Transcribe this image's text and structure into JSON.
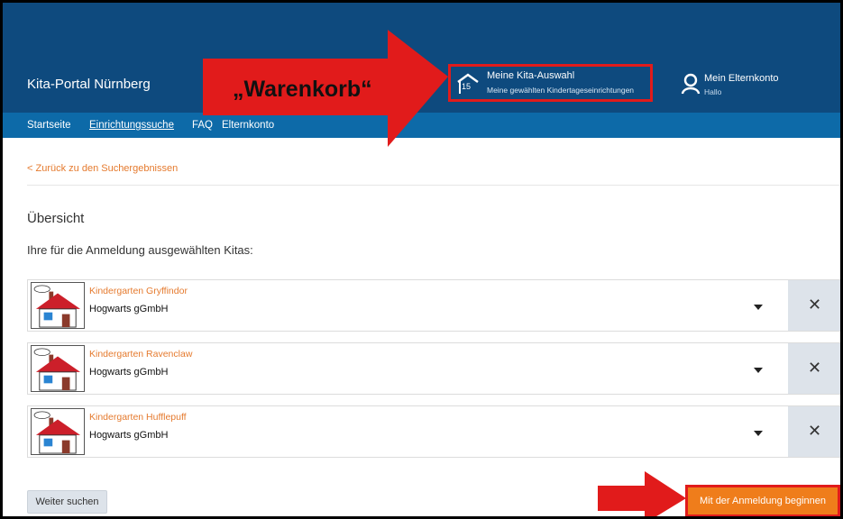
{
  "header": {
    "brand": "Kita-Portal Nürnberg",
    "cart": {
      "title": "Meine Kita-Auswahl",
      "subtitle": "Meine gewählten Kindertageseinrichtungen",
      "count": "15"
    },
    "account": {
      "title": "Mein Elternkonto",
      "subtitle": "Hallo"
    }
  },
  "nav": {
    "items": [
      "Startseite",
      "Einrichtungssuche",
      "FAQ",
      "Elternkonto"
    ],
    "active": "Einrichtungssuche"
  },
  "annotation": {
    "label": "„Warenkorb“",
    "color": "#e11b1b"
  },
  "main": {
    "back_link": "< Zurück zu den Suchergebnissen",
    "section_title": "Übersicht",
    "intro": "Ihre für die Anmeldung ausgewählten Kitas:",
    "kitas": [
      {
        "name": "Kindergarten Gryffindor",
        "org": "Hogwarts gGmbH"
      },
      {
        "name": "Kindergarten Ravenclaw",
        "org": "Hogwarts gGmbH"
      },
      {
        "name": "Kindergarten Hufflepuff",
        "org": "Hogwarts gGmbH"
      }
    ],
    "remove_symbol": "✕"
  },
  "footer": {
    "search_more": "Weiter suchen",
    "start_registration": "Mit der Anmeldung beginnen"
  },
  "colors": {
    "header": "#0e4a7e",
    "nav": "#0d6aa8",
    "accent": "#ef7d1b",
    "link": "#e57a2e"
  }
}
